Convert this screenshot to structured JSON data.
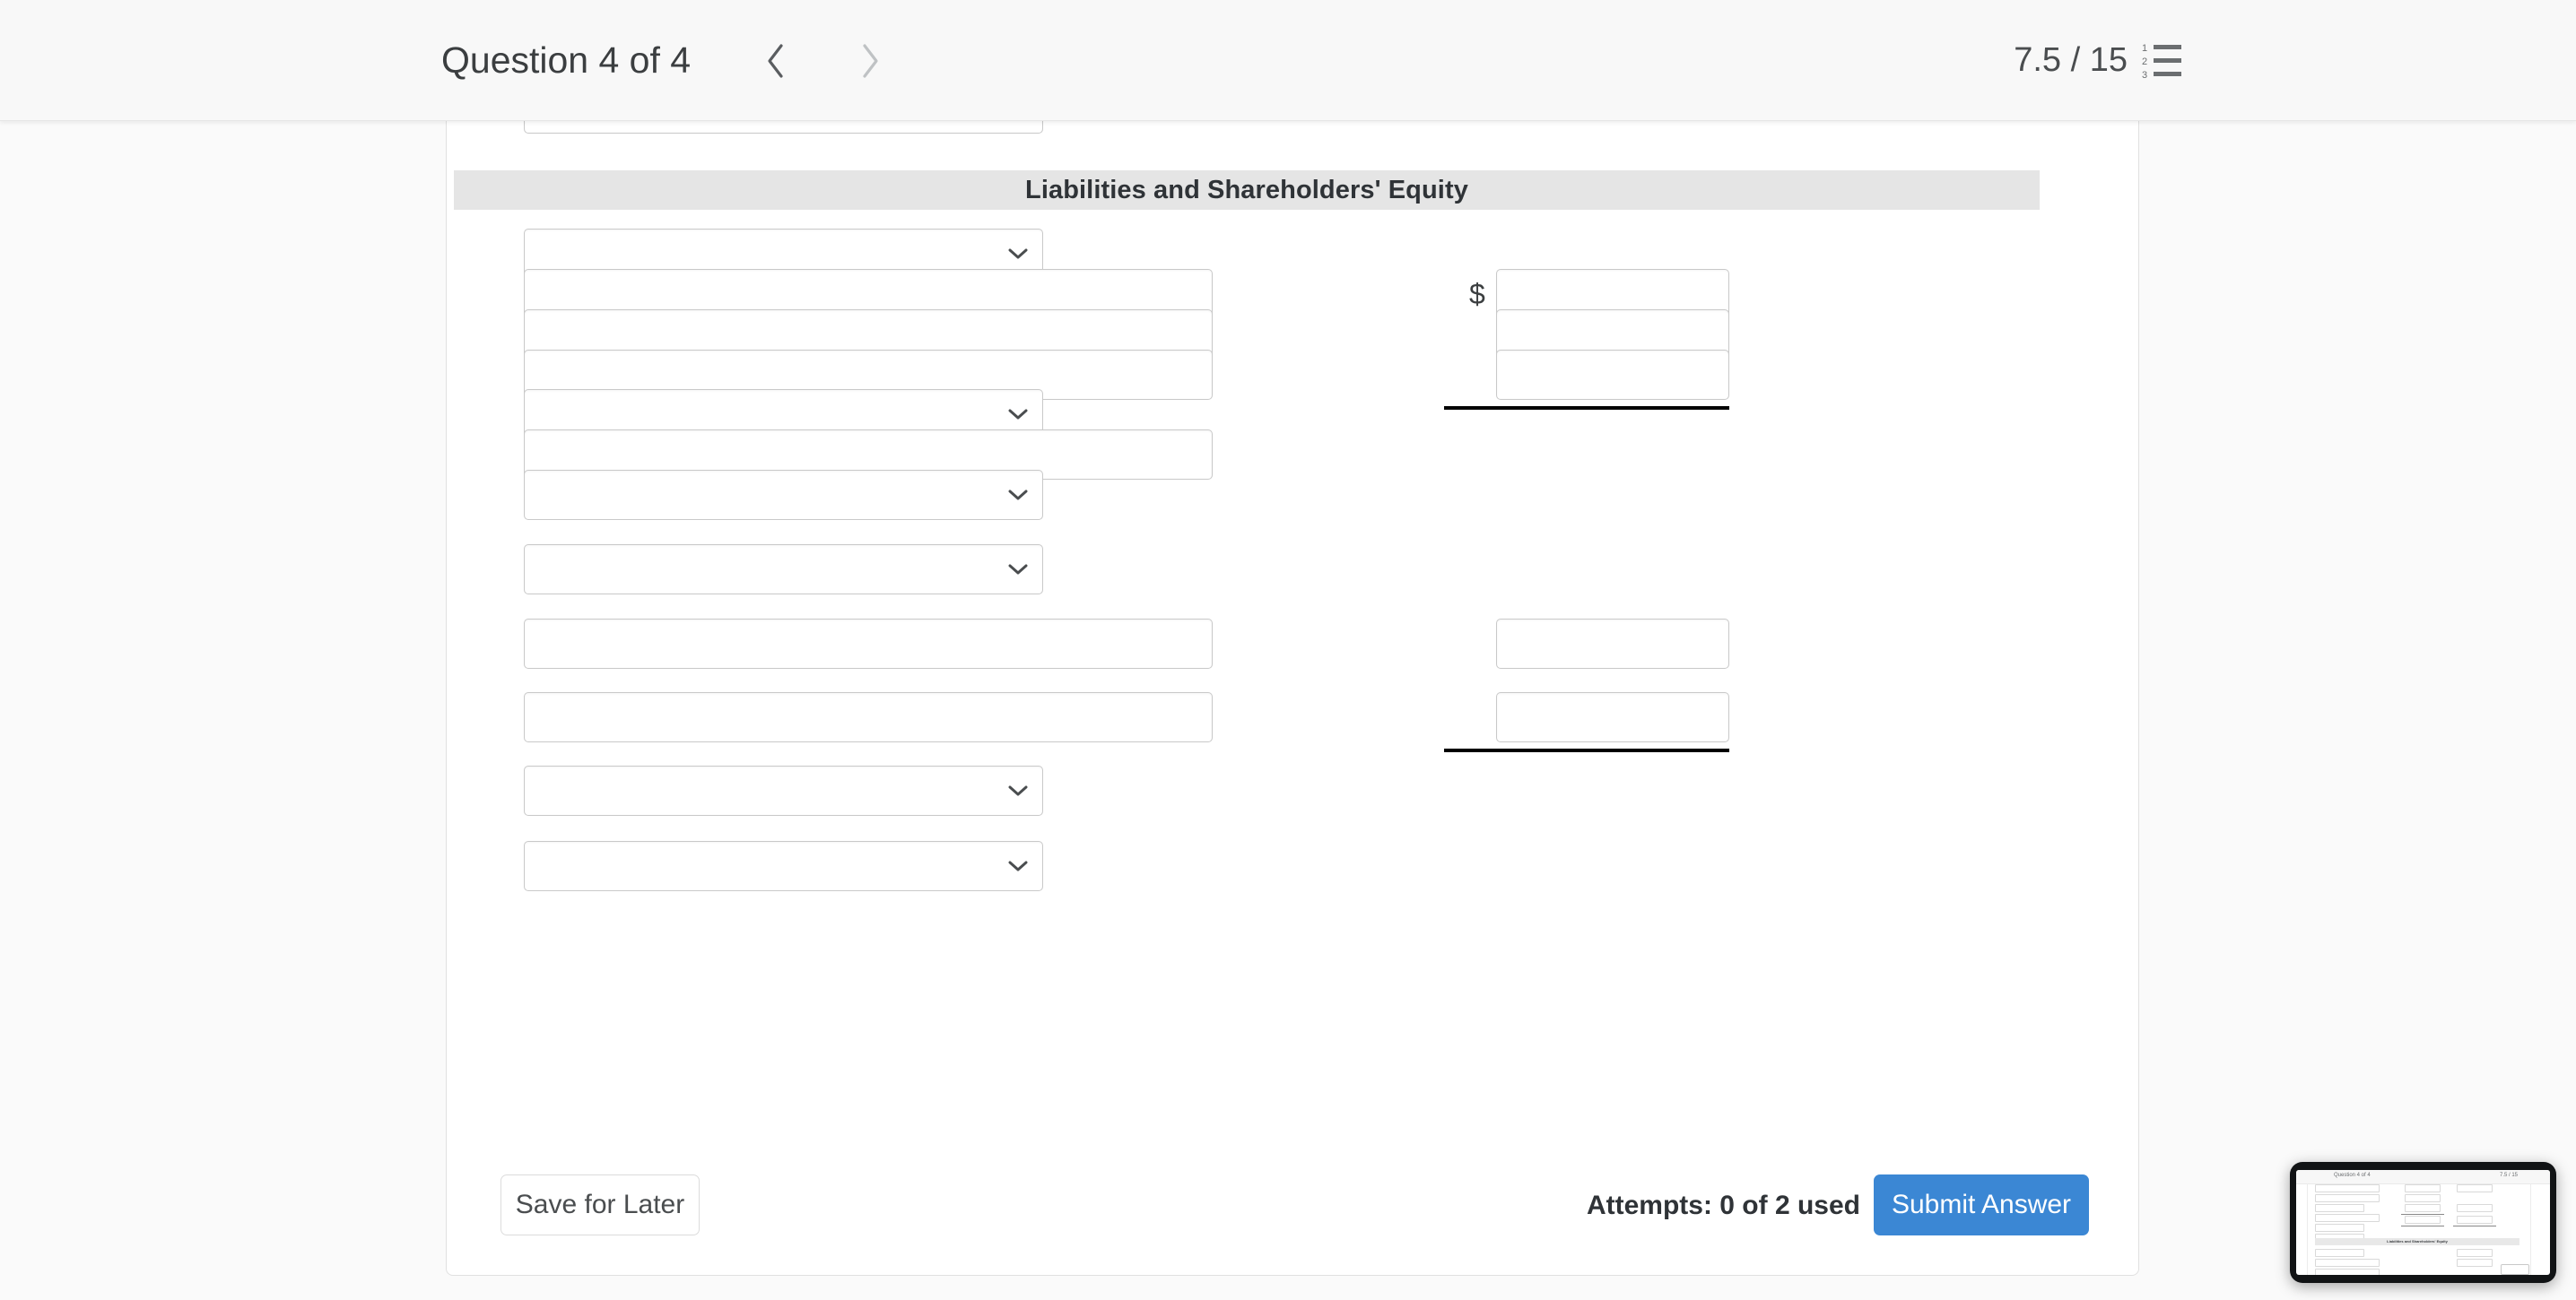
{
  "header": {
    "question_title": "Question 4 of 4",
    "prev_label": "Previous question",
    "next_label": "Next question",
    "score": "7.5 / 15",
    "list_icon": "numbered-list-icon",
    "prev_icon": "chevron-left-icon",
    "next_icon": "chevron-right-icon",
    "prev_color": "#5a5d60",
    "next_color": "#bfc2c4"
  },
  "question": {
    "section_banner": "Liabilities and Shareholders' Equity",
    "currency_symbol": "$",
    "select_placeholder": "",
    "text_placeholder": "",
    "rows": [
      {
        "type": "select",
        "value": "",
        "clipped": true
      },
      {
        "type": "banner",
        "value": "Liabilities and Shareholders' Equity"
      },
      {
        "type": "select",
        "value": ""
      },
      {
        "type": "text",
        "value": "",
        "money": "",
        "dollar": true
      },
      {
        "type": "text",
        "value": "",
        "money": ""
      },
      {
        "type": "text",
        "value": "",
        "money": "",
        "rule": true
      },
      {
        "type": "select",
        "value": ""
      },
      {
        "type": "text",
        "value": ""
      },
      {
        "type": "select",
        "value": ""
      },
      {
        "type": "select",
        "value": ""
      },
      {
        "type": "text",
        "value": "",
        "money": ""
      },
      {
        "type": "text",
        "value": "",
        "money": "",
        "rule": true
      },
      {
        "type": "select",
        "value": ""
      },
      {
        "type": "select",
        "value": ""
      }
    ]
  },
  "footer": {
    "save_label": "Save for Later",
    "attempts_label": "Attempts: 0 of 2 used",
    "submit_label": "Submit Answer",
    "submit_color": "#3b87d4"
  },
  "pip": {
    "title": "Question 4 of 4",
    "score": "7.5 / 15",
    "banner": "Liabilities and Shareholders' Equity"
  }
}
